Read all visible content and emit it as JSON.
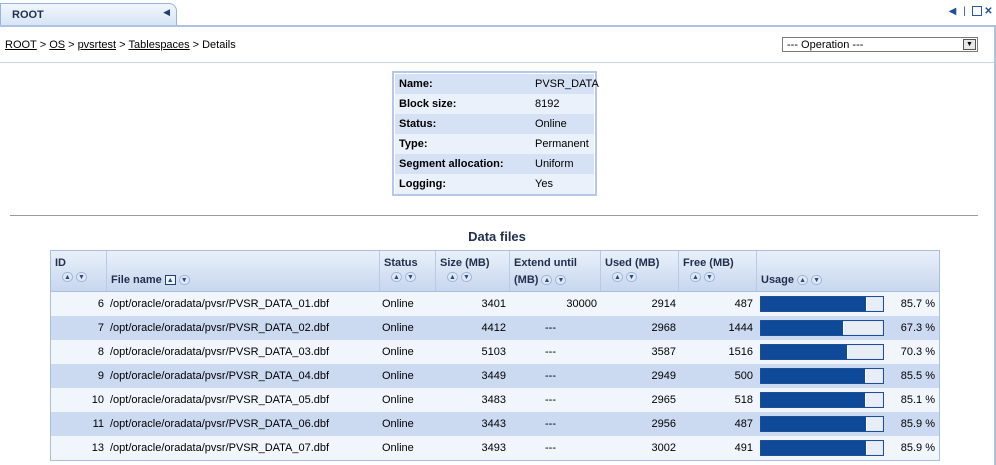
{
  "tab": {
    "title": "ROOT"
  },
  "breadcrumb": [
    {
      "label": "ROOT",
      "link": true
    },
    {
      "label": "OS",
      "link": true
    },
    {
      "label": "pvsrtest",
      "link": true
    },
    {
      "label": "Tablespaces",
      "link": true
    },
    {
      "label": "Details",
      "link": false
    }
  ],
  "operation": {
    "selected": "--- Operation ---"
  },
  "details": [
    {
      "key": "Name:",
      "value": "PVSR_DATA"
    },
    {
      "key": "Block size:",
      "value": "8192"
    },
    {
      "key": "Status:",
      "value": "Online"
    },
    {
      "key": "Type:",
      "value": "Permanent"
    },
    {
      "key": "Segment allocation:",
      "value": "Uniform"
    },
    {
      "key": "Logging:",
      "value": "Yes"
    }
  ],
  "datafiles": {
    "title": "Data files",
    "columns": {
      "id": "ID",
      "file": "File name",
      "status": "Status",
      "size": "Size (MB)",
      "extend1": "Extend until",
      "extend2": "(MB)",
      "used": "Used (MB)",
      "free": "Free (MB)",
      "usage": "Usage"
    },
    "rows": [
      {
        "id": "6",
        "file": "/opt/oracle/oradata/pvsr/PVSR_DATA_01.dbf",
        "status": "Online",
        "size": "3401",
        "extend": "30000",
        "used": "2914",
        "free": "487",
        "usage_pct": 85.7,
        "usage": "85.7 %"
      },
      {
        "id": "7",
        "file": "/opt/oracle/oradata/pvsr/PVSR_DATA_02.dbf",
        "status": "Online",
        "size": "4412",
        "extend": "---",
        "used": "2968",
        "free": "1444",
        "usage_pct": 67.3,
        "usage": "67.3 %"
      },
      {
        "id": "8",
        "file": "/opt/oracle/oradata/pvsr/PVSR_DATA_03.dbf",
        "status": "Online",
        "size": "5103",
        "extend": "---",
        "used": "3587",
        "free": "1516",
        "usage_pct": 70.3,
        "usage": "70.3 %"
      },
      {
        "id": "9",
        "file": "/opt/oracle/oradata/pvsr/PVSR_DATA_04.dbf",
        "status": "Online",
        "size": "3449",
        "extend": "---",
        "used": "2949",
        "free": "500",
        "usage_pct": 85.5,
        "usage": "85.5 %"
      },
      {
        "id": "10",
        "file": "/opt/oracle/oradata/pvsr/PVSR_DATA_05.dbf",
        "status": "Online",
        "size": "3483",
        "extend": "---",
        "used": "2965",
        "free": "518",
        "usage_pct": 85.1,
        "usage": "85.1 %"
      },
      {
        "id": "11",
        "file": "/opt/oracle/oradata/pvsr/PVSR_DATA_06.dbf",
        "status": "Online",
        "size": "3443",
        "extend": "---",
        "used": "2956",
        "free": "487",
        "usage_pct": 85.9,
        "usage": "85.9 %"
      },
      {
        "id": "13",
        "file": "/opt/oracle/oradata/pvsr/PVSR_DATA_07.dbf",
        "status": "Online",
        "size": "3493",
        "extend": "---",
        "used": "3002",
        "free": "491",
        "usage_pct": 85.9,
        "usage": "85.9 %"
      }
    ]
  },
  "colors": {
    "accent": "#0f4a99",
    "header_bg": "#c7d7ee",
    "row_even": "#cbdaf1",
    "row_odd": "#f1f5fc"
  }
}
